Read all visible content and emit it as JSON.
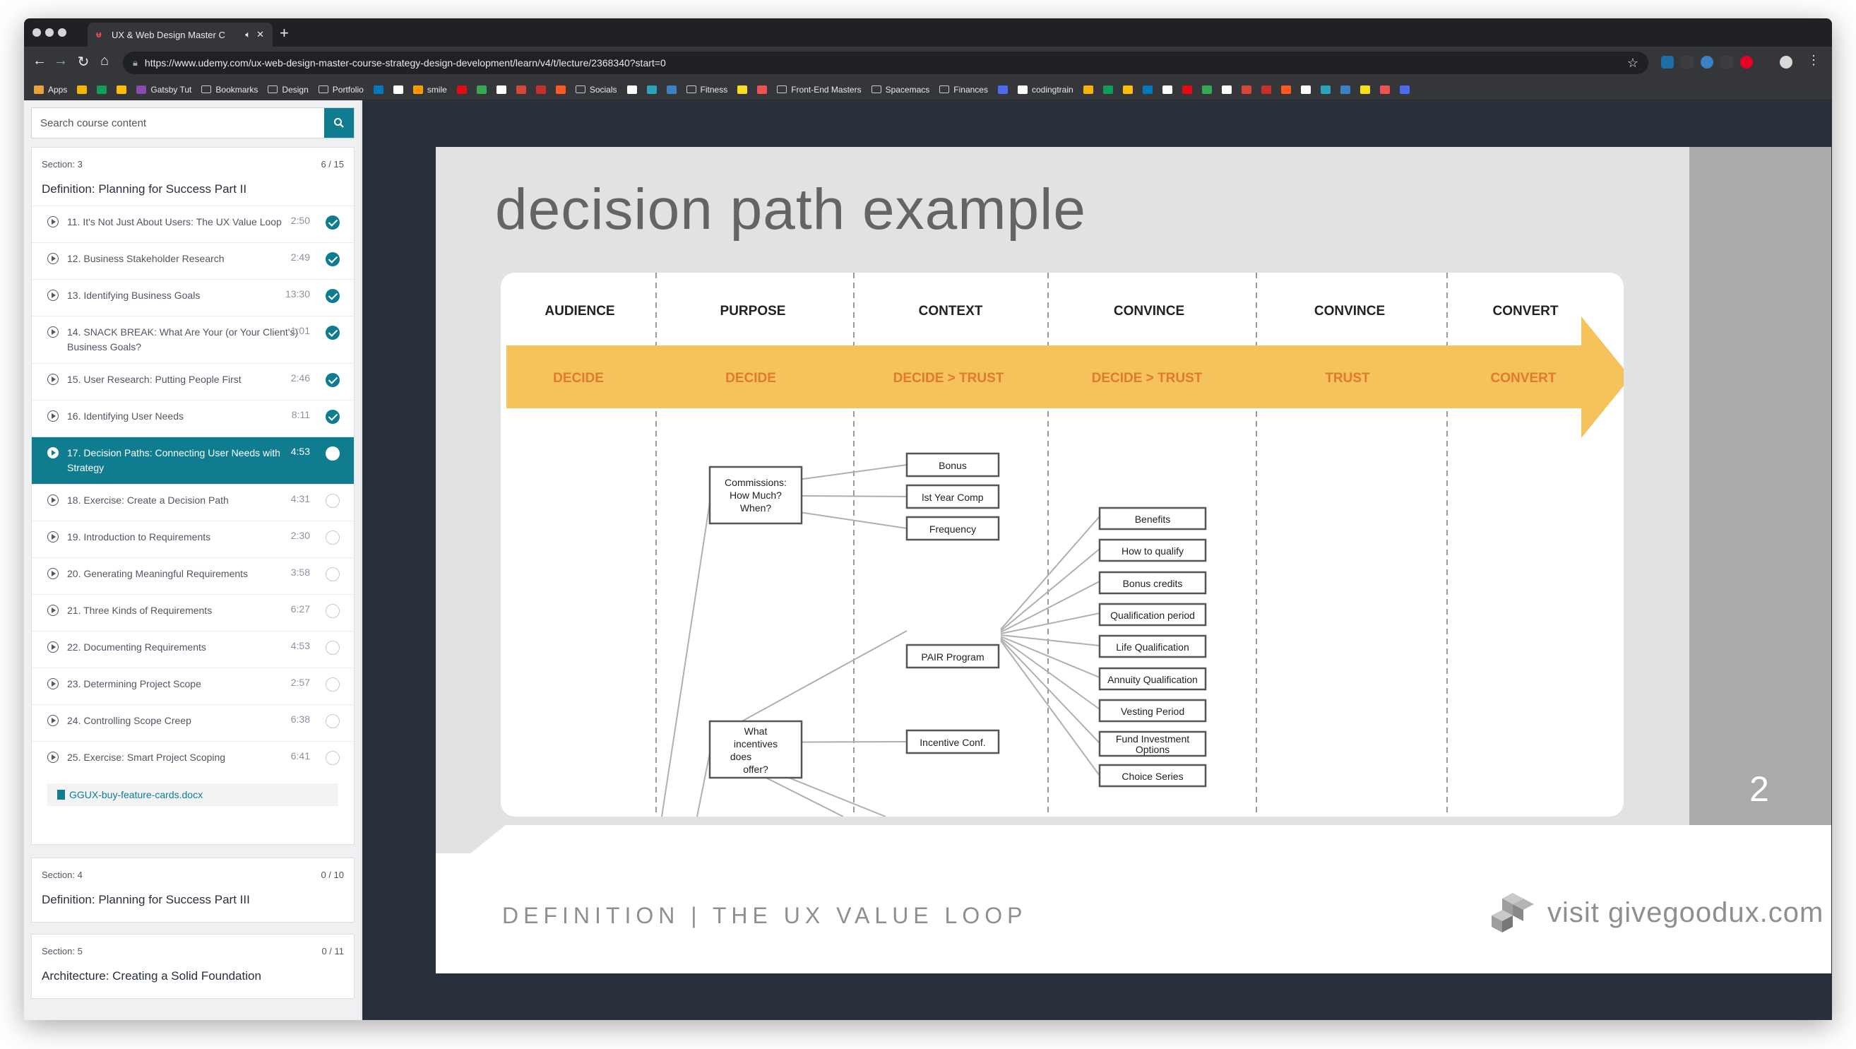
{
  "browser": {
    "tab_title": "UX & Web Design Master C",
    "url": "https://www.udemy.com/ux-web-design-master-course-strategy-design-development/learn/v4/t/lecture/2368340?start=0",
    "bookmarks": [
      {
        "label": "Apps",
        "icon": "apps-grid-icon",
        "color": "#e8a23c"
      },
      {
        "label": "",
        "icon": "drive-icon",
        "color": "#f4b400"
      },
      {
        "label": "",
        "icon": "sheets-icon",
        "color": "#0f9d58"
      },
      {
        "label": "",
        "icon": "ext-icon",
        "color": "#fbbc05"
      },
      {
        "label": "Gatsby Tut",
        "icon": "gatsby-icon",
        "color": "#8a4baf"
      },
      {
        "label": "Bookmarks",
        "icon": "folder-icon",
        "color": ""
      },
      {
        "label": "Design",
        "icon": "folder-icon",
        "color": ""
      },
      {
        "label": "Portfolio",
        "icon": "folder-icon",
        "color": ""
      },
      {
        "label": "",
        "icon": "trello-icon",
        "color": "#0079bf"
      },
      {
        "label": "",
        "icon": "amazon-icon",
        "color": "#ffffff"
      },
      {
        "label": "smile",
        "icon": "smile-icon",
        "color": "#ff9900"
      },
      {
        "label": "",
        "icon": "netflix-icon",
        "color": "#e50914"
      },
      {
        "label": "",
        "icon": "play-store-icon",
        "color": "#34a853"
      },
      {
        "label": "",
        "icon": "github-icon",
        "color": "#ffffff"
      },
      {
        "label": "",
        "icon": "ext-icon",
        "color": "#d44638"
      },
      {
        "label": "",
        "icon": "ext-icon",
        "color": "#c4302b"
      },
      {
        "label": "",
        "icon": "ext-icon",
        "color": "#ff5722"
      },
      {
        "label": "Socials",
        "icon": "folder-icon",
        "color": ""
      },
      {
        "label": "",
        "icon": "doc-icon",
        "color": "#ffffff"
      },
      {
        "label": "",
        "icon": "ext-icon",
        "color": "#2ba3b8"
      },
      {
        "label": "",
        "icon": "ext-icon",
        "color": "#3b82c4"
      },
      {
        "label": "Fitness",
        "icon": "folder-icon",
        "color": ""
      },
      {
        "label": "",
        "icon": "ext-icon",
        "color": "#f7df1e"
      },
      {
        "label": "",
        "icon": "udemy-icon",
        "color": "#ec5252"
      },
      {
        "label": "Front-End Masters",
        "icon": "folder-icon",
        "color": ""
      },
      {
        "label": "Spacemacs",
        "icon": "folder-icon",
        "color": ""
      },
      {
        "label": "Finances",
        "icon": "folder-icon",
        "color": ""
      },
      {
        "label": "",
        "icon": "ext-icon",
        "color": "#4f6bed"
      },
      {
        "label": "codingtrain",
        "icon": "doc-icon",
        "color": "#ffffff"
      },
      {
        "label": "",
        "icon": "drive-icon",
        "color": "#f4b400"
      },
      {
        "label": "",
        "icon": "sheets-icon",
        "color": "#0f9d58"
      },
      {
        "label": "",
        "icon": "ext-icon",
        "color": "#fbbc05"
      },
      {
        "label": "",
        "icon": "trello-icon",
        "color": "#0079bf"
      },
      {
        "label": "",
        "icon": "amazon-icon",
        "color": "#ffffff"
      },
      {
        "label": "",
        "icon": "netflix-icon",
        "color": "#e50914"
      },
      {
        "label": "",
        "icon": "play-store-icon",
        "color": "#34a853"
      },
      {
        "label": "",
        "icon": "github-icon",
        "color": "#ffffff"
      },
      {
        "label": "",
        "icon": "ext-icon",
        "color": "#d44638"
      },
      {
        "label": "",
        "icon": "ext-icon",
        "color": "#c4302b"
      },
      {
        "label": "",
        "icon": "ext-icon",
        "color": "#ff5722"
      },
      {
        "label": "",
        "icon": "doc-icon",
        "color": "#ffffff"
      },
      {
        "label": "",
        "icon": "ext-icon",
        "color": "#2ba3b8"
      },
      {
        "label": "",
        "icon": "ext-icon",
        "color": "#3b82c4"
      },
      {
        "label": "",
        "icon": "ext-icon",
        "color": "#f7df1e"
      },
      {
        "label": "",
        "icon": "udemy-icon",
        "color": "#ec5252"
      },
      {
        "label": "",
        "icon": "ext-icon",
        "color": "#4f6bed"
      }
    ]
  },
  "sidebar": {
    "search_placeholder": "Search course content",
    "sections": [
      {
        "label": "Section: 3",
        "count": "6 / 15",
        "title": "Definition: Planning for Success Part II",
        "lectures": [
          {
            "title": "11. It's Not Just About Users: The UX Value Loop",
            "duration": "2:50",
            "status": "done"
          },
          {
            "title": "12. Business Stakeholder Research",
            "duration": "2:49",
            "status": "done"
          },
          {
            "title": "13. Identifying Business Goals",
            "duration": "13:30",
            "status": "done"
          },
          {
            "title": "14. SNACK BREAK: What Are Your (or Your Client's) Business Goals?",
            "duration": "1:01",
            "status": "done"
          },
          {
            "title": "15. User Research: Putting People First",
            "duration": "2:46",
            "status": "done"
          },
          {
            "title": "16. Identifying User Needs",
            "duration": "8:11",
            "status": "done"
          },
          {
            "title": "17. Decision Paths: Connecting User Needs with Strategy",
            "duration": "4:53",
            "status": "current"
          },
          {
            "title": "18. Exercise: Create a Decision Path",
            "duration": "4:31",
            "status": "todo"
          },
          {
            "title": "19. Introduction to Requirements",
            "duration": "2:30",
            "status": "todo"
          },
          {
            "title": "20. Generating Meaningful Requirements",
            "duration": "3:58",
            "status": "todo"
          },
          {
            "title": "21. Three Kinds of Requirements",
            "duration": "6:27",
            "status": "todo"
          },
          {
            "title": "22. Documenting Requirements",
            "duration": "4:53",
            "status": "todo"
          },
          {
            "title": "23. Determining Project Scope",
            "duration": "2:57",
            "status": "todo"
          },
          {
            "title": "24. Controlling Scope Creep",
            "duration": "6:38",
            "status": "todo"
          },
          {
            "title": "25. Exercise: Smart Project Scoping",
            "duration": "6:41",
            "status": "todo"
          }
        ],
        "resource": "GGUX-buy-feature-cards.docx"
      },
      {
        "label": "Section: 4",
        "count": "0 / 10",
        "title": "Definition: Planning for Success Part III"
      },
      {
        "label": "Section: 5",
        "count": "0 / 11",
        "title": "Architecture: Creating a Solid Foundation"
      }
    ]
  },
  "slide": {
    "title": "decision path example",
    "page_number": "2",
    "footer_left": "DEFINITION | THE UX VALUE LOOP",
    "footer_right_prefix": "visit ",
    "footer_right_brand_a": "give",
    "footer_right_brand_b": "good",
    "footer_right_brand_c": "ux.com",
    "columns": [
      {
        "header": "AUDIENCE",
        "stage": "DECIDE"
      },
      {
        "header": "PURPOSE",
        "stage": "DECIDE"
      },
      {
        "header": "CONTEXT",
        "stage": "DECIDE > TRUST"
      },
      {
        "header": "CONVINCE",
        "stage": "DECIDE > TRUST"
      },
      {
        "header": "CONVINCE",
        "stage": "TRUST"
      },
      {
        "header": "CONVERT",
        "stage": "CONVERT"
      }
    ],
    "boxes": {
      "commissions": [
        "Commissions:",
        "How Much?",
        "When?"
      ],
      "incentives": [
        "What",
        "incentives",
        "does",
        "offer?"
      ],
      "bonus": "Bonus",
      "first_year": "lst Year Comp",
      "frequency": "Frequency",
      "pair": "PAIR Program",
      "incentive_conf": "Incentive Conf.",
      "benefits": "Benefits",
      "how_to_qualify": "How to qualify",
      "bonus_credits": "Bonus credits",
      "qualification_period": "Qualification period",
      "life_qualification": "Life Qualification",
      "annuity_qualification": "Annuity Qualification",
      "vesting_period": "Vesting Period",
      "fund_investment": [
        "Fund Investment",
        "Options"
      ],
      "choice_series": "Choice Series"
    },
    "colors": {
      "arrow": "#f5c25c",
      "arrow_text": "#e07b2e",
      "accent": "#0f7c90"
    }
  }
}
